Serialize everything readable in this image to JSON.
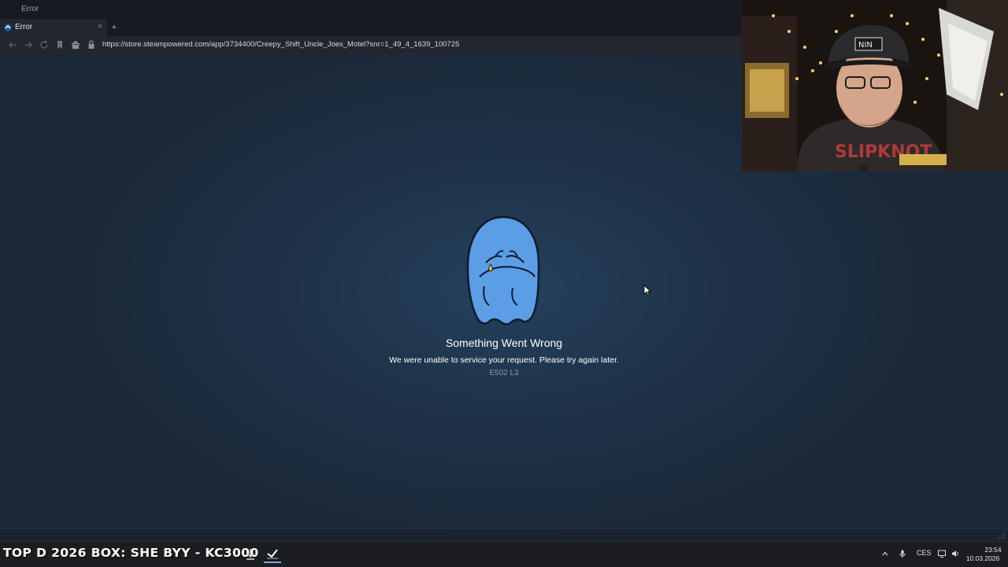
{
  "window": {
    "title": "Error"
  },
  "tab": {
    "label": "Error",
    "close": "×",
    "new": "+"
  },
  "navbar": {
    "url": "https://store.steampowered.com/app/3734400/Creepy_Shift_Uncle_Joes_Motel?snr=1_49_4_1639_100725"
  },
  "error": {
    "title": "Something Went Wrong",
    "message": "We were unable to service your request. Please try again later.",
    "code": "E502 L3"
  },
  "overlay": {
    "ticker": "TOP D 2026 BOX: SHE  BYY - KC3000"
  },
  "taskbar": {
    "apps": [
      "download-app",
      "steam-app"
    ],
    "tray": {
      "language": "CES",
      "time": "23:54",
      "date": "10.03.2026"
    }
  },
  "colors": {
    "page_bg": "#1b2838",
    "mascot": "#5c9ee6",
    "accent": "#66c0f4"
  },
  "icons": [
    "back-icon",
    "forward-icon",
    "reload-icon",
    "bookmark-icon",
    "home-icon",
    "lock-icon",
    "steam-icon",
    "chevron-up-icon",
    "microphone-icon",
    "monitor-icon",
    "speaker-icon",
    "resize-grip-icon"
  ]
}
